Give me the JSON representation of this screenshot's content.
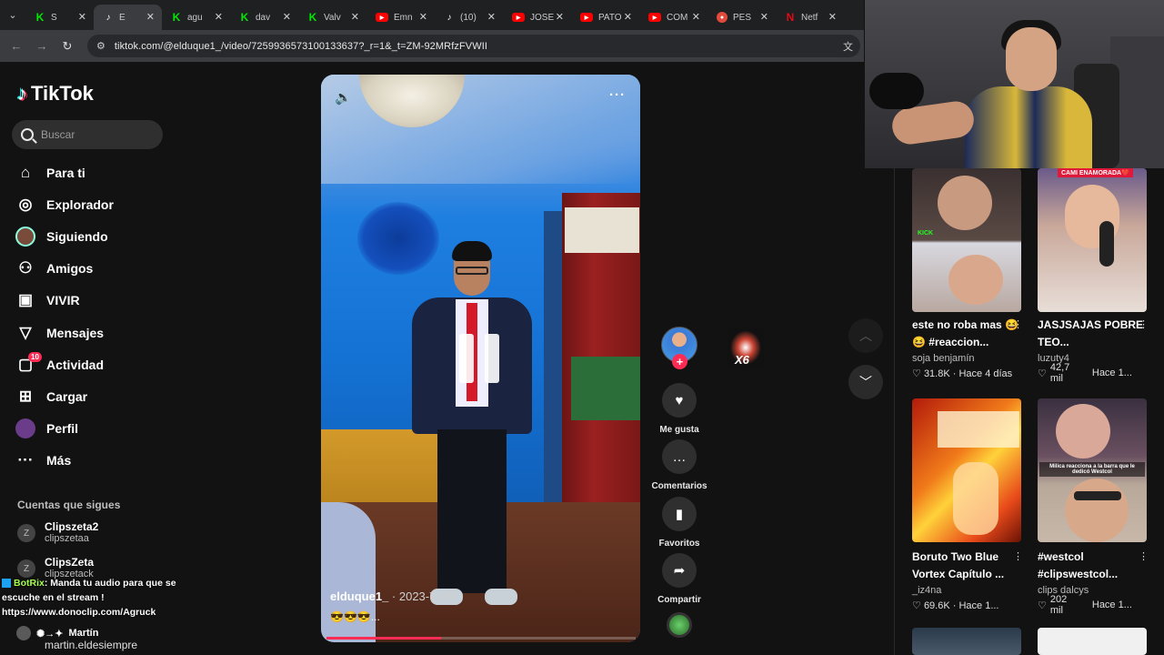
{
  "browser": {
    "tabs": [
      {
        "icon": "kick",
        "label": "S"
      },
      {
        "icon": "tiktok",
        "label": "E"
      },
      {
        "icon": "kick",
        "label": "agu"
      },
      {
        "icon": "kick",
        "label": "dav"
      },
      {
        "icon": "kick",
        "label": "Valv"
      },
      {
        "icon": "youtube",
        "label": "Emn"
      },
      {
        "icon": "tiktok",
        "label": "(10)"
      },
      {
        "icon": "youtube",
        "label": "JOSE"
      },
      {
        "icon": "youtube",
        "label": "PATO"
      },
      {
        "icon": "youtube",
        "label": "COM"
      },
      {
        "icon": "pes",
        "label": "PES"
      },
      {
        "icon": "netflix",
        "label": "Netf"
      }
    ],
    "url": "tiktok.com/@elduque1_/video/7259936573100133637?_r=1&_t=ZM-92MRfzFVWII"
  },
  "sidebar": {
    "logo": "TikTok",
    "search_placeholder": "Buscar",
    "nav": [
      {
        "label": "Para ti",
        "icon": "home-icon"
      },
      {
        "label": "Explorador",
        "icon": "compass-icon"
      },
      {
        "label": "Siguiendo",
        "icon": "following-avatar"
      },
      {
        "label": "Amigos",
        "icon": "friends-icon"
      },
      {
        "label": "VIVIR",
        "icon": "live-tv-icon"
      },
      {
        "label": "Mensajes",
        "icon": "paper-plane-icon"
      },
      {
        "label": "Actividad",
        "icon": "inbox-icon",
        "badge": "10"
      },
      {
        "label": "Cargar",
        "icon": "upload-icon"
      },
      {
        "label": "Perfil",
        "icon": "profile-avatar"
      },
      {
        "label": "Más",
        "icon": "more-icon"
      }
    ],
    "following_title": "Cuentas que sigues",
    "following": [
      {
        "name": "Clipszeta2",
        "username": "clipszetaa"
      },
      {
        "name": "ClipsZeta",
        "username": "clipszetack"
      }
    ]
  },
  "chat": {
    "bot_name": "BotRix",
    "message": ": Manda tu audio para que se escuche en el stream !",
    "link": "https://www.donoclip.com/Agruck",
    "user": "Martín",
    "user_handle": "martin.eldesiempre"
  },
  "video": {
    "author": "elduque1_",
    "date": "2023-7-25",
    "description": "😎😎😎...",
    "progress_fraction": 0.37
  },
  "actions": {
    "like": "Me gusta",
    "comments": "Comentarios",
    "favorites": "Favoritos",
    "share": "Compartir"
  },
  "sticker_label": "X6",
  "recommendations": [
    {
      "title": "este no roba mas 😆😆 #reaccion...",
      "user": "soja benjamín",
      "views": "31.8K",
      "time": "Hace 4 días"
    },
    {
      "title": "JASJSAJAS POBRE TEO...",
      "user": "luzuty4",
      "views": "42,7 mil",
      "time": "Hace 1..."
    },
    {
      "title": "Boruto Two Blue Vortex Capítulo ...",
      "user": "_iz4na",
      "views": "69.6K",
      "time": "Hace 1..."
    },
    {
      "title": "#westcol #clipswestcol...",
      "user": "clips dalcys",
      "views": "202 mil",
      "time": "Hace 1..."
    }
  ],
  "thumb_captions": {
    "thumb2": "CAMI ENAMORADA❤️",
    "thumb4": "Milica reacciona a la barra que le dedicó Westcol"
  },
  "colors": {
    "accent": "#fe2c55",
    "background": "#121212",
    "tab_active": "#3b3c3f"
  }
}
